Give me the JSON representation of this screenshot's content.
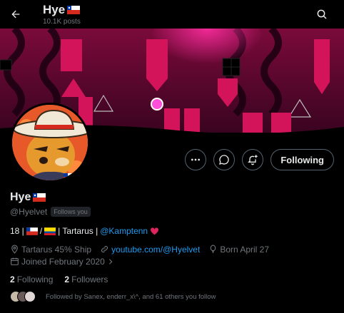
{
  "header": {
    "title": "Hye",
    "posts": "10.1K posts"
  },
  "profile": {
    "display_name": "Hye",
    "handle": "@Hyelvet",
    "follows_you": "Follows you",
    "following_label": "Following",
    "bio_prefix": "18 |",
    "bio_mid": "| Tartarus |",
    "bio_link": "@Kamptenn",
    "location": "Tartarus 45% Ship",
    "website": "youtube.com/@Hyelvet",
    "birthday": "Born April 27",
    "joined": "Joined February 2020",
    "following_count": "2",
    "following_label_text": "Following",
    "followers_count": "2",
    "followers_label_text": "Followers",
    "followed_by": "Followed by Sanex, enderr_x\\^, and 61 others you follow"
  },
  "colors": {
    "accent": "#1d9bf0",
    "banner_pink": "#d4145a",
    "text_secondary": "#71767b"
  },
  "icons": [
    "back-arrow-icon",
    "search-icon",
    "more-icon",
    "message-icon",
    "notify-plus-icon",
    "location-icon",
    "link-icon",
    "balloon-icon",
    "calendar-icon"
  ]
}
